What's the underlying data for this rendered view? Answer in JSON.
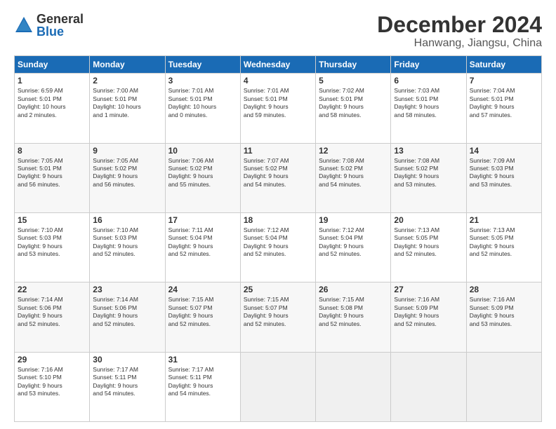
{
  "header": {
    "logo_general": "General",
    "logo_blue": "Blue",
    "month_title": "December 2024",
    "location": "Hanwang, Jiangsu, China"
  },
  "days_of_week": [
    "Sunday",
    "Monday",
    "Tuesday",
    "Wednesday",
    "Thursday",
    "Friday",
    "Saturday"
  ],
  "weeks": [
    [
      {
        "day": "1",
        "lines": [
          "Sunrise: 6:59 AM",
          "Sunset: 5:01 PM",
          "Daylight: 10 hours",
          "and 2 minutes."
        ]
      },
      {
        "day": "2",
        "lines": [
          "Sunrise: 7:00 AM",
          "Sunset: 5:01 PM",
          "Daylight: 10 hours",
          "and 1 minute."
        ]
      },
      {
        "day": "3",
        "lines": [
          "Sunrise: 7:01 AM",
          "Sunset: 5:01 PM",
          "Daylight: 10 hours",
          "and 0 minutes."
        ]
      },
      {
        "day": "4",
        "lines": [
          "Sunrise: 7:01 AM",
          "Sunset: 5:01 PM",
          "Daylight: 9 hours",
          "and 59 minutes."
        ]
      },
      {
        "day": "5",
        "lines": [
          "Sunrise: 7:02 AM",
          "Sunset: 5:01 PM",
          "Daylight: 9 hours",
          "and 58 minutes."
        ]
      },
      {
        "day": "6",
        "lines": [
          "Sunrise: 7:03 AM",
          "Sunset: 5:01 PM",
          "Daylight: 9 hours",
          "and 58 minutes."
        ]
      },
      {
        "day": "7",
        "lines": [
          "Sunrise: 7:04 AM",
          "Sunset: 5:01 PM",
          "Daylight: 9 hours",
          "and 57 minutes."
        ]
      }
    ],
    [
      {
        "day": "8",
        "lines": [
          "Sunrise: 7:05 AM",
          "Sunset: 5:01 PM",
          "Daylight: 9 hours",
          "and 56 minutes."
        ]
      },
      {
        "day": "9",
        "lines": [
          "Sunrise: 7:05 AM",
          "Sunset: 5:02 PM",
          "Daylight: 9 hours",
          "and 56 minutes."
        ]
      },
      {
        "day": "10",
        "lines": [
          "Sunrise: 7:06 AM",
          "Sunset: 5:02 PM",
          "Daylight: 9 hours",
          "and 55 minutes."
        ]
      },
      {
        "day": "11",
        "lines": [
          "Sunrise: 7:07 AM",
          "Sunset: 5:02 PM",
          "Daylight: 9 hours",
          "and 54 minutes."
        ]
      },
      {
        "day": "12",
        "lines": [
          "Sunrise: 7:08 AM",
          "Sunset: 5:02 PM",
          "Daylight: 9 hours",
          "and 54 minutes."
        ]
      },
      {
        "day": "13",
        "lines": [
          "Sunrise: 7:08 AM",
          "Sunset: 5:02 PM",
          "Daylight: 9 hours",
          "and 53 minutes."
        ]
      },
      {
        "day": "14",
        "lines": [
          "Sunrise: 7:09 AM",
          "Sunset: 5:03 PM",
          "Daylight: 9 hours",
          "and 53 minutes."
        ]
      }
    ],
    [
      {
        "day": "15",
        "lines": [
          "Sunrise: 7:10 AM",
          "Sunset: 5:03 PM",
          "Daylight: 9 hours",
          "and 53 minutes."
        ]
      },
      {
        "day": "16",
        "lines": [
          "Sunrise: 7:10 AM",
          "Sunset: 5:03 PM",
          "Daylight: 9 hours",
          "and 52 minutes."
        ]
      },
      {
        "day": "17",
        "lines": [
          "Sunrise: 7:11 AM",
          "Sunset: 5:04 PM",
          "Daylight: 9 hours",
          "and 52 minutes."
        ]
      },
      {
        "day": "18",
        "lines": [
          "Sunrise: 7:12 AM",
          "Sunset: 5:04 PM",
          "Daylight: 9 hours",
          "and 52 minutes."
        ]
      },
      {
        "day": "19",
        "lines": [
          "Sunrise: 7:12 AM",
          "Sunset: 5:04 PM",
          "Daylight: 9 hours",
          "and 52 minutes."
        ]
      },
      {
        "day": "20",
        "lines": [
          "Sunrise: 7:13 AM",
          "Sunset: 5:05 PM",
          "Daylight: 9 hours",
          "and 52 minutes."
        ]
      },
      {
        "day": "21",
        "lines": [
          "Sunrise: 7:13 AM",
          "Sunset: 5:05 PM",
          "Daylight: 9 hours",
          "and 52 minutes."
        ]
      }
    ],
    [
      {
        "day": "22",
        "lines": [
          "Sunrise: 7:14 AM",
          "Sunset: 5:06 PM",
          "Daylight: 9 hours",
          "and 52 minutes."
        ]
      },
      {
        "day": "23",
        "lines": [
          "Sunrise: 7:14 AM",
          "Sunset: 5:06 PM",
          "Daylight: 9 hours",
          "and 52 minutes."
        ]
      },
      {
        "day": "24",
        "lines": [
          "Sunrise: 7:15 AM",
          "Sunset: 5:07 PM",
          "Daylight: 9 hours",
          "and 52 minutes."
        ]
      },
      {
        "day": "25",
        "lines": [
          "Sunrise: 7:15 AM",
          "Sunset: 5:07 PM",
          "Daylight: 9 hours",
          "and 52 minutes."
        ]
      },
      {
        "day": "26",
        "lines": [
          "Sunrise: 7:15 AM",
          "Sunset: 5:08 PM",
          "Daylight: 9 hours",
          "and 52 minutes."
        ]
      },
      {
        "day": "27",
        "lines": [
          "Sunrise: 7:16 AM",
          "Sunset: 5:09 PM",
          "Daylight: 9 hours",
          "and 52 minutes."
        ]
      },
      {
        "day": "28",
        "lines": [
          "Sunrise: 7:16 AM",
          "Sunset: 5:09 PM",
          "Daylight: 9 hours",
          "and 53 minutes."
        ]
      }
    ],
    [
      {
        "day": "29",
        "lines": [
          "Sunrise: 7:16 AM",
          "Sunset: 5:10 PM",
          "Daylight: 9 hours",
          "and 53 minutes."
        ]
      },
      {
        "day": "30",
        "lines": [
          "Sunrise: 7:17 AM",
          "Sunset: 5:11 PM",
          "Daylight: 9 hours",
          "and 54 minutes."
        ]
      },
      {
        "day": "31",
        "lines": [
          "Sunrise: 7:17 AM",
          "Sunset: 5:11 PM",
          "Daylight: 9 hours",
          "and 54 minutes."
        ]
      },
      null,
      null,
      null,
      null
    ]
  ]
}
